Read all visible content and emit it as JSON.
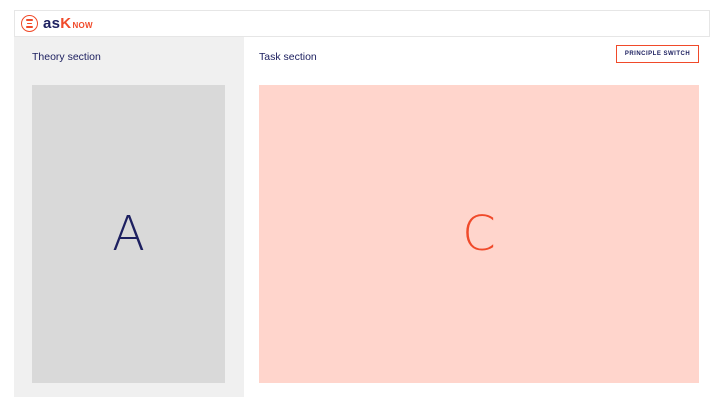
{
  "header": {
    "logo_main": "as",
    "logo_k": "K",
    "logo_now": "NOW",
    "brand_color": "#f04a2a",
    "text_color": "#1d2060"
  },
  "theory": {
    "label": "Theory section",
    "placeholder_letter": "A"
  },
  "task": {
    "label": "Task section",
    "button_label": "PRINCIPLE SWITCH",
    "placeholder_letter": "C"
  },
  "icons": {
    "menu": "menu-icon"
  }
}
